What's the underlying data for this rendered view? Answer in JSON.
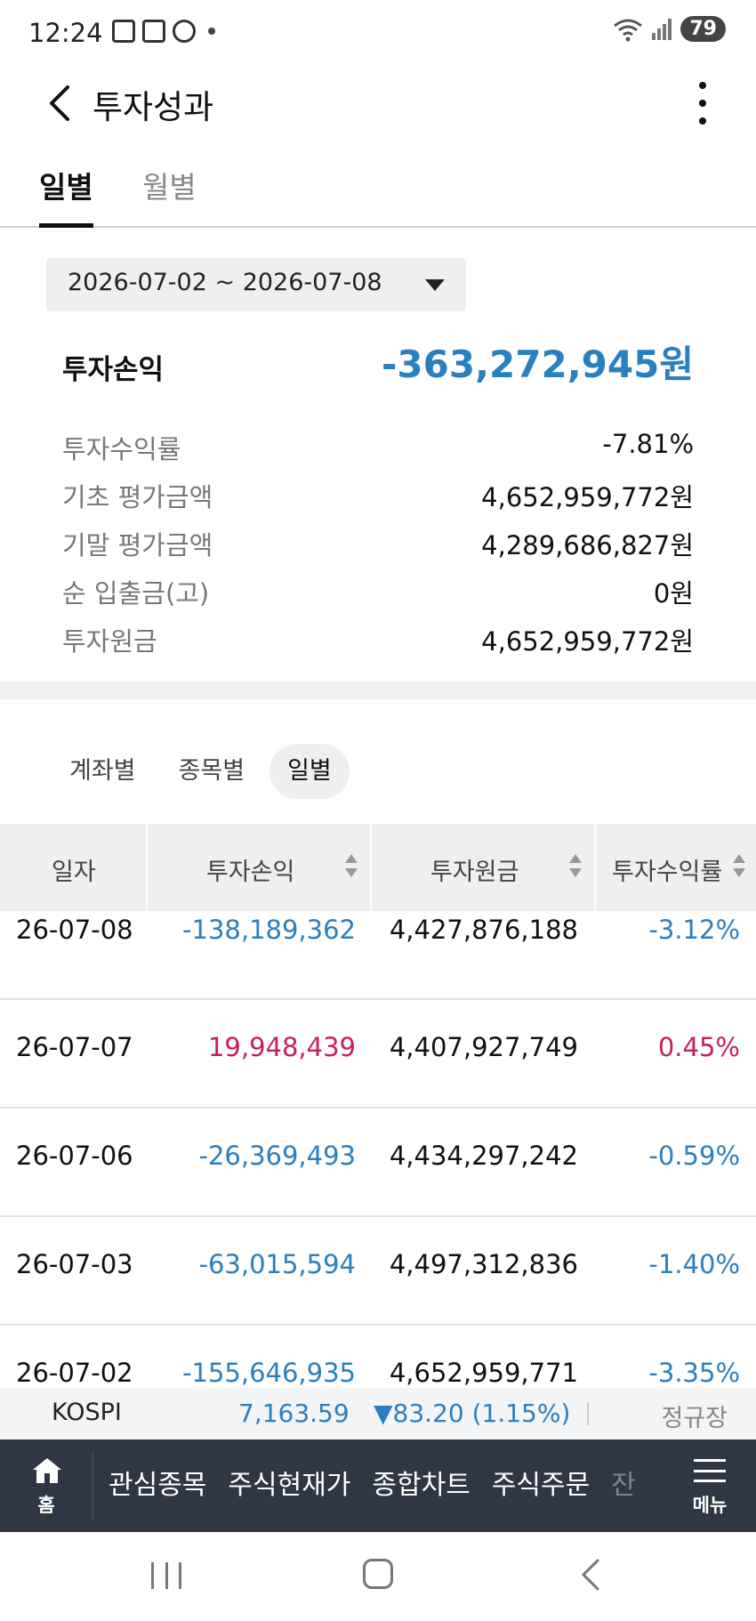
{
  "status_bar": {
    "time": "12:24",
    "battery": "79",
    "icons": [
      "notification-icon",
      "calendar-icon",
      "fan-icon",
      "dot-icon",
      "wifi-icon",
      "signal-icon"
    ]
  },
  "header": {
    "title": "투자성과",
    "icons": [
      "back-icon",
      "more-vert-icon"
    ]
  },
  "period_tabs": [
    {
      "label": "일별",
      "active": true
    },
    {
      "label": "월별",
      "active": false
    }
  ],
  "date_range": "2026-07-02 ~ 2026-07-08",
  "summary": {
    "profit_label": "투자손익",
    "profit_value": "-363,272,945원",
    "rows": [
      {
        "label": "투자수익률",
        "value": "-7.81%"
      },
      {
        "label": "기초 평가금액",
        "value": "4,652,959,772원"
      },
      {
        "label": "기말 평가금액",
        "value": "4,289,686,827원"
      },
      {
        "label": "순 입출금(고)",
        "value": "0원"
      },
      {
        "label": "투자원금",
        "value": "4,652,959,772원"
      }
    ]
  },
  "view_tabs": [
    {
      "label": "계좌별",
      "active": false
    },
    {
      "label": "종목별",
      "active": false
    },
    {
      "label": "일별",
      "active": true
    }
  ],
  "table": {
    "headers": [
      "일자",
      "투자손익",
      "투자원금",
      "투자수익률"
    ],
    "rows": [
      {
        "date": "26-07-08",
        "profit": "-138,189,362",
        "principal": "4,427,876,188",
        "rate": "-3.12%"
      },
      {
        "date": "26-07-07",
        "profit": "19,948,439",
        "principal": "4,407,927,749",
        "rate": "0.45%"
      },
      {
        "date": "26-07-06",
        "profit": "-26,369,493",
        "principal": "4,434,297,242",
        "rate": "-0.59%"
      },
      {
        "date": "26-07-03",
        "profit": "-63,015,594",
        "principal": "4,497,312,836",
        "rate": "-1.40%"
      },
      {
        "date": "26-07-02",
        "profit": "-155,646,935",
        "principal": "4,652,959,771",
        "rate": "-3.35%"
      }
    ]
  },
  "ticker": {
    "name": "KOSPI",
    "value": "7,163.59",
    "change": "▼83.20 (1.15%)",
    "session": "정규장"
  },
  "bottom_nav": {
    "home_label": "홈",
    "items": [
      "관심종목",
      "주식현재가",
      "종합차트",
      "주식주문",
      "잔"
    ],
    "menu_label": "메뉴"
  },
  "colors": {
    "negative": "#2a7fbf",
    "positive": "#c81f5a",
    "nav_bg": "#2f3644"
  }
}
